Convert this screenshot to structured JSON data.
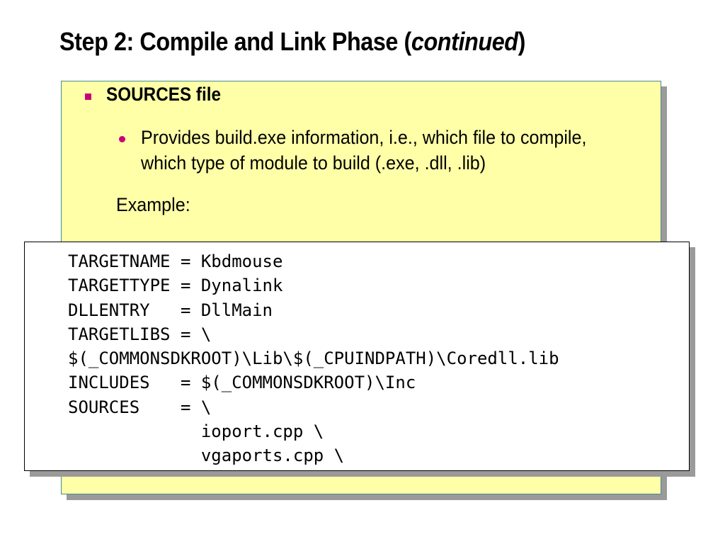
{
  "title": {
    "main": "Step 2: Compile and Link Phase (",
    "italic": "continued",
    "close": ")"
  },
  "bullet1": "SOURCES file",
  "bullet2": "Provides build.exe information, i.e., which file to compile, which type of module to build (.exe, .dll, .lib)",
  "example_label": "Example:",
  "code_lines": [
    "TARGETNAME = Kbdmouse",
    "TARGETTYPE = Dynalink",
    "DLLENTRY   = DllMain",
    "TARGETLIBS = \\",
    "$(_COMMONSDKROOT)\\Lib\\$(_CPUINDPATH)\\Coredll.lib",
    "INCLUDES   = $(_COMMONSDKROOT)\\Inc",
    "SOURCES    = \\",
    "             ioport.cpp \\",
    "             vgaports.cpp \\"
  ],
  "colors": {
    "panel_bg": "#ffffa8",
    "bullet": "#c8007a",
    "panel_border": "#4a8c8c"
  }
}
